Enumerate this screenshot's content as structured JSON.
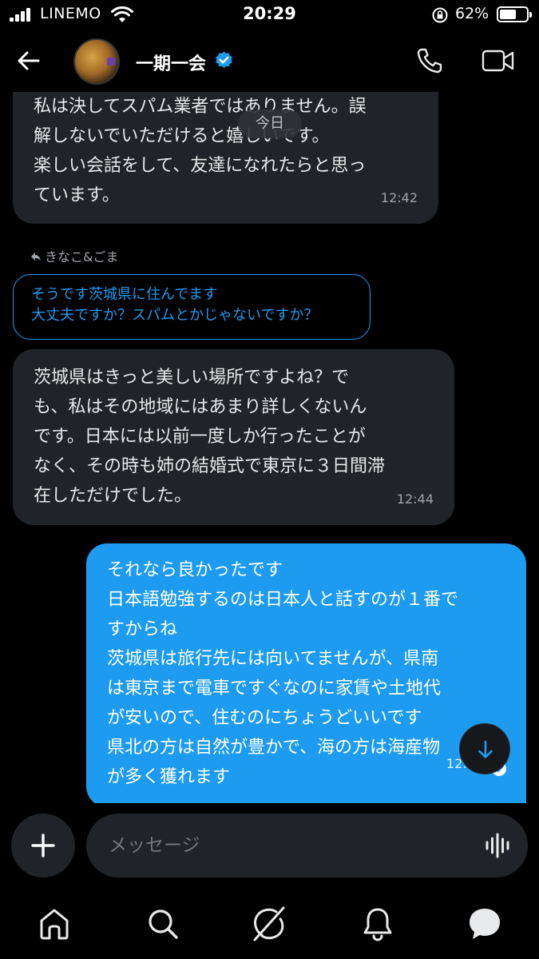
{
  "status_bar": {
    "carrier": "LINEMO",
    "time": "20:29",
    "battery_percent": "62%",
    "battery_level": 0.62
  },
  "header": {
    "contact_name": "一期一会",
    "verified": true,
    "back_icon": "arrow-left-icon",
    "call_icon": "phone-icon",
    "video_icon": "video-camera-icon"
  },
  "messages": {
    "date_divider": "今日",
    "msg1": {
      "text": "私は決してスパム業者ではありません。誤\n解しないでいただけると嬉しいです。\n楽しい会話をして、友達になれたらと思っ\nています。",
      "time": "12:42"
    },
    "reply_to": {
      "label": "きなこ&ごま",
      "quoted_text": "そうです茨城県に住んでます\n大丈夫ですか？スパムとかじゃないですか？"
    },
    "msg2": {
      "text": "茨城県はきっと美しい場所ですよね？で\nも、私はその地域にはあまり詳しくないん\nです。日本には以前一度しか行ったことが\nなく、その時も姉の結婚式で東京に３日間滞\n在しただけでした。",
      "time": "12:44"
    },
    "msg3": {
      "text": "それなら良かったです\n日本語勉強するのは日本人と話すのが１番で\nすからね\n茨城県は旅行先には向いてませんが、県南\nは東京まで電車ですぐなのに家賃や土地代\nが安いので、住むのにちょうどいいです\n県北の方は自然が豊かで、海の方は海産物\nが多く獲れます",
      "time": "12:49"
    }
  },
  "composer": {
    "placeholder": "メッセージ"
  },
  "nav": {
    "items": [
      "home-icon",
      "search-icon",
      "grok-icon",
      "notifications-icon",
      "messages-icon"
    ]
  },
  "colors": {
    "accent": "#1d9bf0",
    "bubble_incoming": "#202327",
    "background": "#000000"
  }
}
